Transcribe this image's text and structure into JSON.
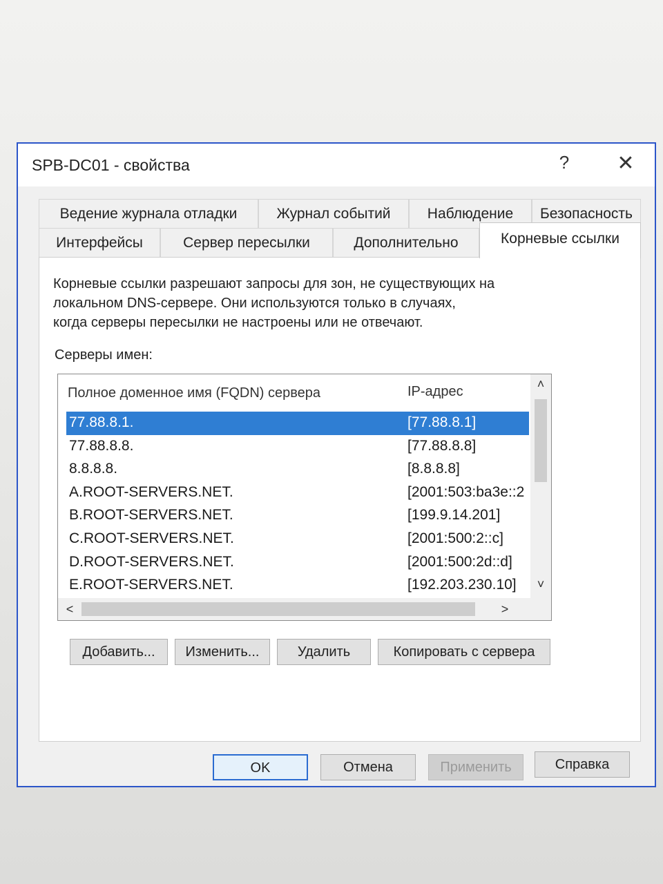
{
  "window": {
    "title": "SPB-DC01 - свойства",
    "help_glyph": "?",
    "close_glyph": "✕"
  },
  "tabs": {
    "row1": [
      {
        "label": "Ведение журнала отладки"
      },
      {
        "label": "Журнал событий"
      },
      {
        "label": "Наблюдение"
      },
      {
        "label": "Безопасность"
      }
    ],
    "row2": [
      {
        "label": "Интерфейсы"
      },
      {
        "label": "Сервер пересылки"
      },
      {
        "label": "Дополнительно"
      },
      {
        "label": "Корневые ссылки"
      }
    ],
    "active": "Корневые ссылки"
  },
  "panel": {
    "description_lines": [
      "Корневые ссылки разрешают запросы для зон, не существующих на",
      "локальном DNS-сервере.  Они используются только в случаях,",
      "когда серверы пересылки не настроены или не отвечают."
    ],
    "servers_label": "Серверы имен:",
    "columns": {
      "name": "Полное доменное имя (FQDN) сервера",
      "ip": "IP-адрес"
    },
    "rows": [
      {
        "name": "77.88.8.1.",
        "ip": "[77.88.8.1]",
        "selected": true
      },
      {
        "name": "77.88.8.8.",
        "ip": "[77.88.8.8]",
        "selected": false
      },
      {
        "name": "8.8.8.8.",
        "ip": "[8.8.8.8]",
        "selected": false
      },
      {
        "name": "A.ROOT-SERVERS.NET.",
        "ip": "[2001:503:ba3e::2",
        "selected": false
      },
      {
        "name": "B.ROOT-SERVERS.NET.",
        "ip": "[199.9.14.201]",
        "selected": false
      },
      {
        "name": "C.ROOT-SERVERS.NET.",
        "ip": "[2001:500:2::c]",
        "selected": false
      },
      {
        "name": "D.ROOT-SERVERS.NET.",
        "ip": "[2001:500:2d::d]",
        "selected": false
      },
      {
        "name": "E.ROOT-SERVERS.NET.",
        "ip": "[192.203.230.10]",
        "selected": false
      }
    ],
    "scroll_glyphs": {
      "up": "˄",
      "down": "˅",
      "left": "<",
      "right": ">"
    },
    "buttons": {
      "add": "Добавить...",
      "edit": "Изменить...",
      "remove": "Удалить",
      "copy": "Копировать с сервера"
    }
  },
  "footer": {
    "ok": "OK",
    "cancel": "Отмена",
    "apply": "Применить",
    "help": "Справка"
  },
  "colors": {
    "selection": "#2f7ed3",
    "dialog_border": "#2b55c9",
    "primary_border": "#2a6bd1"
  }
}
